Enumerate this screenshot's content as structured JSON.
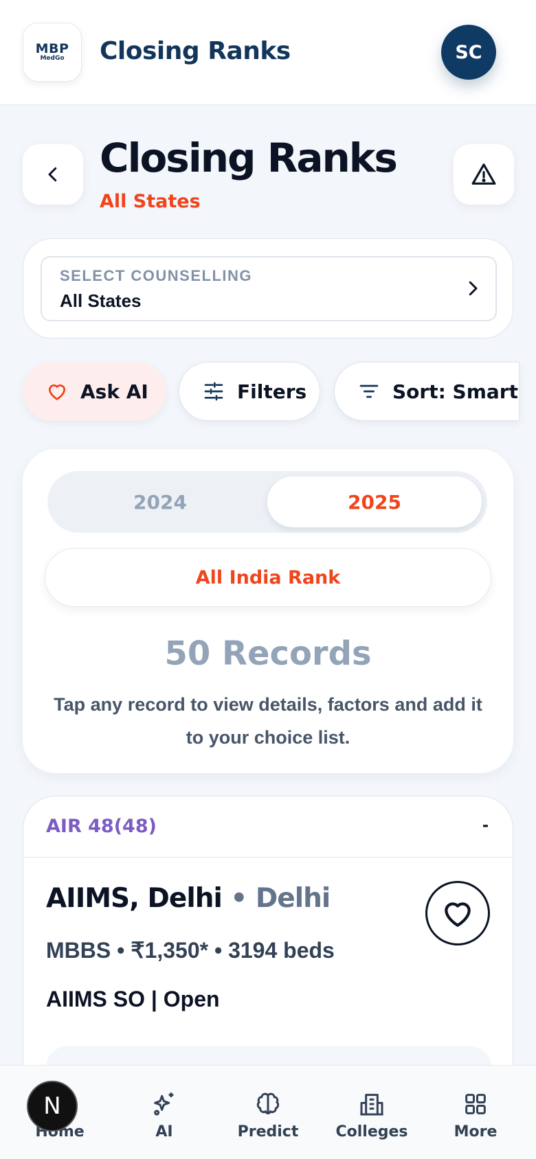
{
  "header": {
    "logo_line1": "MBP",
    "logo_line2": "MedGo",
    "title": "Closing Ranks",
    "avatar_initials": "SC"
  },
  "page": {
    "title": "Closing Ranks",
    "subtitle": "All States"
  },
  "counselling": {
    "label": "SELECT COUNSELLING",
    "value": "All States"
  },
  "chips": {
    "ask_ai": "Ask AI",
    "filters": "Filters",
    "sort": "Sort: Smart"
  },
  "years": {
    "options": [
      "2024",
      "2025"
    ],
    "selected": "2025"
  },
  "rank_type": "All India Rank",
  "records": {
    "count_label": "50 Records",
    "hint": "Tap any record to view details, factors and add it to your choice list."
  },
  "record": {
    "air": "AIR 48(48)",
    "trailing": "-",
    "college": "AIIMS, Delhi",
    "separator": " • ",
    "state": "Delhi",
    "meta": "MBBS • ₹1,350* • 3194 beds",
    "quota": "AIIMS SO | Open"
  },
  "nav": {
    "items": [
      "Home",
      "AI",
      "Predict",
      "Colleges",
      "More"
    ]
  },
  "dev_badge": "N",
  "colors": {
    "brand": "#12355b",
    "accent": "#f0441c",
    "air": "#7c5cc4"
  }
}
